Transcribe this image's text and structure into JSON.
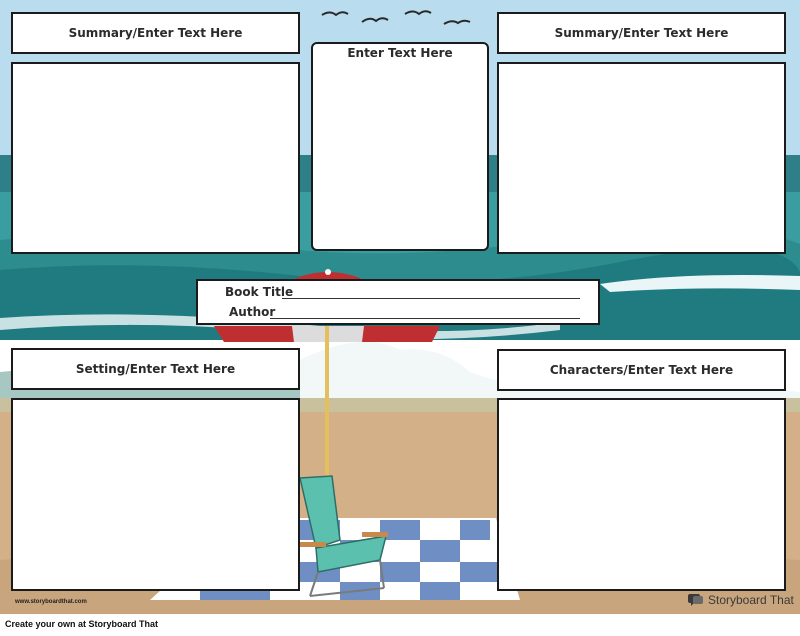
{
  "panels": {
    "top_left_title": "Summary/Enter Text Here",
    "top_center_title": "Enter Text Here",
    "top_right_title": "Summary/Enter Text Here",
    "bottom_left_title": "Setting/Enter Text Here",
    "bottom_right_title": "Characters/Enter Text Here"
  },
  "book_info": {
    "title_label": "Book Title",
    "author_label": "Author"
  },
  "branding": {
    "watermark": "www.storyboardthat.com",
    "logo_text": "Storyboard That",
    "footer": "Create your own at Storyboard That"
  },
  "colors": {
    "sky": "#b9dcef",
    "sea": "#2e8f92",
    "sand": "#d4b088",
    "umbrella_red": "#bf2f31",
    "chair": "#5bc0ad",
    "blanket_blue": "#6f8fc4"
  }
}
